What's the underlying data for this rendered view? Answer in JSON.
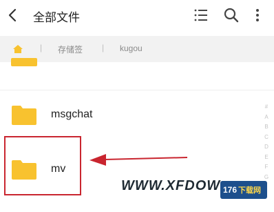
{
  "header": {
    "title": "全部文件"
  },
  "breadcrumb": {
    "items": [
      "存储签",
      "kugou"
    ]
  },
  "files": [
    {
      "name": ""
    },
    {
      "name": "msgchat"
    },
    {
      "name": "mv"
    }
  ],
  "index_letters": [
    "#",
    "A",
    "B",
    "C",
    "D",
    "E",
    "F",
    "G"
  ],
  "watermark": {
    "text": "WWW.XFDOW",
    "brand_number": "176",
    "brand_text": "下载网"
  },
  "colors": {
    "folder": "#f8c22f",
    "highlight": "#c9252f",
    "crumb_bg": "#f2f2f2"
  }
}
